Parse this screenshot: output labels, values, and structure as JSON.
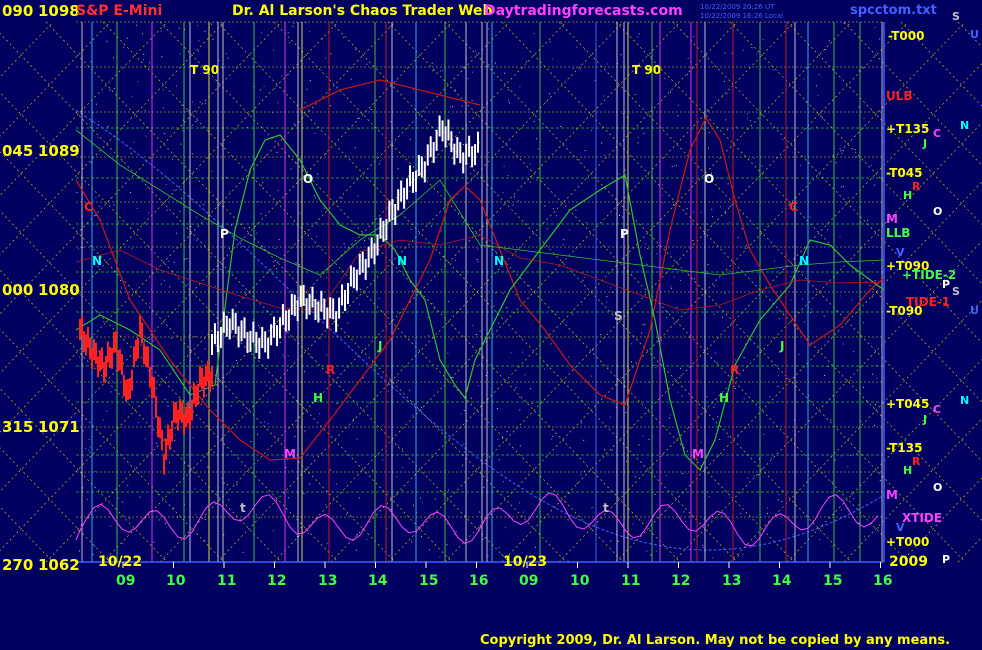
{
  "header": {
    "instrument": "S&P E-Mini",
    "title": "Dr. Al Larson's Chaos Trader Web",
    "site": "Daytradingforecasts.com",
    "stamp_1": "10/22/2009 20:26 UT",
    "stamp_2": "10/22/2009 16:26 Local",
    "filename": "spcctom.txt"
  },
  "copyright": "Copyright 2009, Dr. Al Larson. May not be copied by any means.",
  "colors": {
    "background": "#000060",
    "grid_yellow": "#d8d800",
    "grid_green": "#20c020",
    "price_white": "#ffffff",
    "price_red": "#ff2020",
    "line_red": "#c01818",
    "line_green": "#30c030",
    "line_magenta": "#ff40ff",
    "accent_blue": "#4060ff",
    "cyan": "#00ffff",
    "yellow_text": "#ffff00",
    "gray_text": "#c0c0c0"
  },
  "chart_data": {
    "type": "line",
    "ylim": [
      1062,
      1098
    ],
    "left_axis": [
      {
        "angle": "090",
        "price": "1098",
        "value": 1098
      },
      {
        "angle": "045",
        "price": "1089",
        "value": 1089
      },
      {
        "angle": "000",
        "price": "1080",
        "value": 1080
      },
      {
        "angle": "315",
        "price": "1071",
        "value": 1071
      },
      {
        "angle": "270",
        "price": "1062",
        "value": 1062
      }
    ],
    "dates": [
      "10/22",
      "10/23"
    ],
    "year": "2009",
    "hours_day1": [
      "09",
      "10",
      "11",
      "12",
      "13",
      "14",
      "15",
      "16"
    ],
    "hours_day2": [
      "09",
      "10",
      "11",
      "12",
      "13",
      "14",
      "15",
      "16"
    ],
    "series": [
      {
        "color": "red",
        "values": [
          1077.5,
          1076.0,
          1075.0,
          1076.5,
          1073.0,
          1077.5,
          1074.0,
          1069.0,
          1072.0,
          1071.5,
          1074.0,
          1074.5
        ]
      },
      {
        "color": "white",
        "values": [
          1076.5,
          1078.0,
          1077.0,
          1076.5,
          1078.0,
          1079.5,
          1079.0,
          1078.5,
          1081.0,
          1082.5,
          1085.0,
          1087.0,
          1088.5,
          1091.0,
          1089.0,
          1089.5
        ]
      }
    ],
    "right_labels": [
      {
        "text": "-T000",
        "color": "yellow"
      },
      {
        "text": "ULB",
        "color": "red"
      },
      {
        "text": "+T135",
        "color": "yellow"
      },
      {
        "text": "-T045",
        "color": "yellow"
      },
      {
        "text": "M",
        "color": "magenta"
      },
      {
        "text": "LLB",
        "color": "green"
      },
      {
        "text": "+T090",
        "color": "yellow"
      },
      {
        "text": "+TIDE-2",
        "color": "green"
      },
      {
        "text": "TIDE-1",
        "color": "red"
      },
      {
        "text": "-T090",
        "color": "yellow"
      },
      {
        "text": "+T045",
        "color": "yellow"
      },
      {
        "text": "-T135",
        "color": "yellow"
      },
      {
        "text": "M",
        "color": "magenta"
      },
      {
        "text": "XTIDE",
        "color": "magenta"
      },
      {
        "text": "+T000",
        "color": "yellow"
      }
    ],
    "outer_letters": [
      {
        "text": "S",
        "color": "gray"
      },
      {
        "text": "U",
        "color": "blue"
      },
      {
        "text": "N",
        "color": "cyan"
      },
      {
        "text": "C",
        "color": "magenta"
      },
      {
        "text": "J",
        "color": "green"
      },
      {
        "text": "R",
        "color": "red"
      },
      {
        "text": "H",
        "color": "green"
      },
      {
        "text": "O",
        "color": "white"
      },
      {
        "text": "V",
        "color": "blue"
      },
      {
        "text": "P",
        "color": "white"
      },
      {
        "text": "S",
        "color": "gray"
      },
      {
        "text": "U",
        "color": "blue"
      },
      {
        "text": "N",
        "color": "cyan"
      },
      {
        "text": "C",
        "color": "magenta"
      },
      {
        "text": "J",
        "color": "green"
      },
      {
        "text": "R",
        "color": "red"
      },
      {
        "text": "H",
        "color": "green"
      },
      {
        "text": "O",
        "color": "white"
      },
      {
        "text": "V",
        "color": "blue"
      },
      {
        "text": "P",
        "color": "white"
      }
    ],
    "chart_letters": [
      {
        "text": "T 90",
        "color": "yellow"
      },
      {
        "text": "T 90",
        "color": "yellow"
      },
      {
        "text": "O",
        "color": "white"
      },
      {
        "text": "O",
        "color": "white"
      },
      {
        "text": "C",
        "color": "red"
      },
      {
        "text": "C",
        "color": "red"
      },
      {
        "text": "P",
        "color": "white"
      },
      {
        "text": "P",
        "color": "white"
      },
      {
        "text": "N",
        "color": "cyan"
      },
      {
        "text": "N",
        "color": "cyan"
      },
      {
        "text": "N",
        "color": "cyan"
      },
      {
        "text": "N",
        "color": "cyan"
      },
      {
        "text": "S",
        "color": "gray"
      },
      {
        "text": "J",
        "color": "green"
      },
      {
        "text": "J",
        "color": "green"
      },
      {
        "text": "H",
        "color": "green"
      },
      {
        "text": "H",
        "color": "green"
      },
      {
        "text": "R",
        "color": "red"
      },
      {
        "text": "R",
        "color": "red"
      },
      {
        "text": "M",
        "color": "magenta"
      },
      {
        "text": "M",
        "color": "magenta"
      },
      {
        "text": "t",
        "color": "gray"
      },
      {
        "text": "t",
        "color": "gray"
      }
    ]
  }
}
